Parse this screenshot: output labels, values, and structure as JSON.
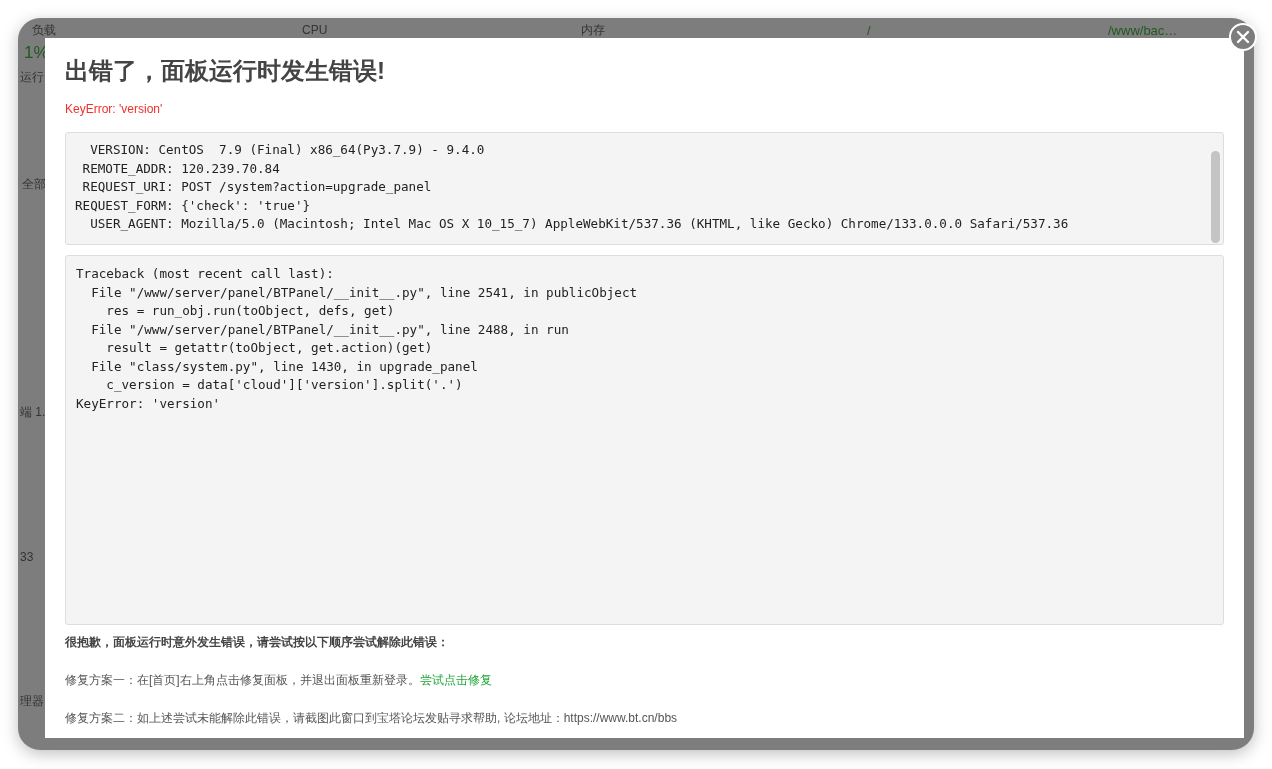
{
  "background": {
    "labels": [
      {
        "text": "负载",
        "kind": "plain"
      },
      {
        "text": "1%",
        "kind": "accent"
      },
      {
        "text": "运行",
        "kind": "plain"
      },
      {
        "text": "CPU",
        "kind": "plain"
      },
      {
        "text": "内存",
        "kind": "plain"
      },
      {
        "text": "/",
        "kind": "accent"
      },
      {
        "text": "/www/bac…",
        "kind": "accent"
      },
      {
        "text": "全部",
        "kind": "plain"
      },
      {
        "text": "端 1.",
        "kind": "plain"
      },
      {
        "text": "33",
        "kind": "plain"
      },
      {
        "text": "理器",
        "kind": "plain"
      }
    ]
  },
  "dialog": {
    "title": "出错了，面板运行时发生错误!",
    "error": "KeyError: 'version'",
    "request_info": [
      "  VERSION: CentOS  7.9 (Final) x86_64(Py3.7.9) - 9.4.0",
      " REMOTE_ADDR: 120.239.70.84",
      " REQUEST_URI: POST /system?action=upgrade_panel",
      "REQUEST_FORM: {'check': 'true'}",
      "  USER_AGENT: Mozilla/5.0 (Macintosh; Intel Mac OS X 10_15_7) AppleWebKit/537.36 (KHTML, like Gecko) Chrome/133.0.0.0 Safari/537.36"
    ],
    "traceback": [
      "Traceback (most recent call last):",
      "  File \"/www/server/panel/BTPanel/__init__.py\", line 2541, in publicObject",
      "    res = run_obj.run(toObject, defs, get)",
      "  File \"/www/server/panel/BTPanel/__init__.py\", line 2488, in run",
      "    result = getattr(toObject, get.action)(get)",
      "  File \"class/system.py\", line 1430, in upgrade_panel",
      "    c_version = data['cloud']['version'].split('.')",
      "KeyError: 'version'"
    ],
    "apology": "很抱歉，面板运行时意外发生错误，请尝试按以下顺序尝试解除此错误：",
    "fix_one": {
      "text": "修复方案一：在[首页]右上角点击修复面板，并退出面板重新登录。",
      "link": "尝试点击修复"
    },
    "fix_two": "修复方案二：如上述尝试未能解除此错误，请截图此窗口到宝塔论坛发贴寻求帮助, 论坛地址：https://www.bt.cn/bbs"
  }
}
